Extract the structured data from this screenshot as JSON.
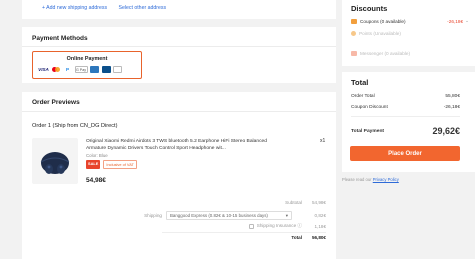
{
  "address": {
    "add_new": "+ Add new shipping address",
    "select_other": "Select other address"
  },
  "payment": {
    "title": "Payment Methods",
    "method_label": "Online Payment",
    "logos": [
      "visa-logo",
      "mastercard-logo",
      "paypal-logo",
      "gpay-logo",
      "amex-logo",
      "bank-logo",
      "generic-card-logo"
    ],
    "logo_text": {
      "visa": "VISA",
      "paypal": "P",
      "gpay": "G Pay"
    }
  },
  "orders": {
    "title": "Order Previews",
    "subtitle": "Order 1 (Ship from CN_DG Direct)",
    "item": {
      "title": "Original Xiaomi Redmi Airdots 3 TWS bluetooth 5.2 Earphone HiFi Stereo Balanced Armature Dynamic Drivers Touch Control Sport Headphone wit...",
      "color": "Color: Blue",
      "quantity": "x1",
      "badge_sale": "SALE",
      "badge_vat": "Inclusive of VAT",
      "price": "54,98€"
    },
    "summary": {
      "subtotal_label": "Subtotal",
      "subtotal_value": "54,98€",
      "shipping_label": "Shipping",
      "shipping_option": "Banggood Express (0.82€ & 10-15 business days)",
      "shipping_value": "0,82€",
      "insurance_label": "Shipping Insurance ⓘ",
      "insurance_value": "1,18€",
      "total_label": "Total",
      "total_value": "56,80€"
    }
  },
  "discounts": {
    "title": "Discounts",
    "coupons_label": "Coupons (0 available)",
    "coupons_amount": "-26,18€",
    "points_label": "Points (Unavailable)",
    "message_label": "Messenger (0 available)"
  },
  "total": {
    "title": "Total",
    "order_total_label": "Order Total",
    "order_total_value": "55,80€",
    "coupon_discount_label": "Coupon Discount",
    "coupon_discount_value": "-26,18€",
    "total_payment_label": "Total Payment",
    "total_payment_value": "29,62€",
    "place_order": "Place Order"
  },
  "privacy": {
    "prefix": "Please read our ",
    "link": "Privacy Policy"
  },
  "colors": {
    "accent": "#f2662f",
    "discount_red": "#e8442c",
    "link_blue": "#2e6bd8"
  }
}
